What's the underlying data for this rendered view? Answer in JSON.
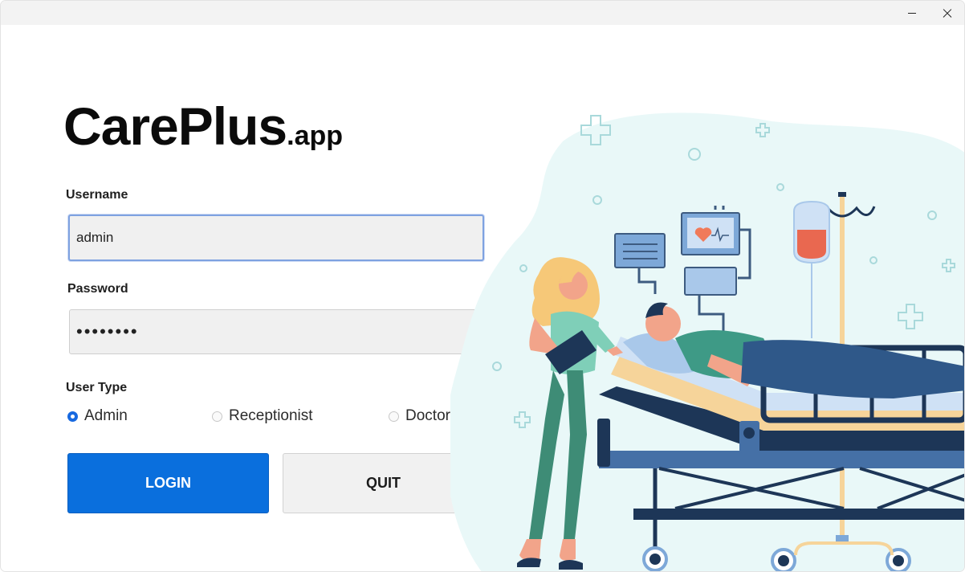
{
  "window": {
    "controls": {
      "minimize_icon": "minimize-icon",
      "close_icon": "close-icon"
    }
  },
  "logo": {
    "main": "CarePlus",
    "suffix": ".app"
  },
  "form": {
    "username_label": "Username",
    "username_value": "admin",
    "password_label": "Password",
    "password_value": "••••••••",
    "user_type_label": "User Type",
    "user_types": [
      "Admin",
      "Receptionist",
      "Doctor"
    ],
    "selected_user_type": "Admin"
  },
  "buttons": {
    "login": "LOGIN",
    "quit": "QUIT"
  },
  "colors": {
    "primary": "#0a6fdd",
    "illustration_bg": "#e8f8f8",
    "bed_frame": "#1d3657",
    "mattress": "#f6d49a",
    "nurse_scrubs": "#3e8c76"
  },
  "illustration": {
    "icon": "hospital-bed-illustration"
  }
}
